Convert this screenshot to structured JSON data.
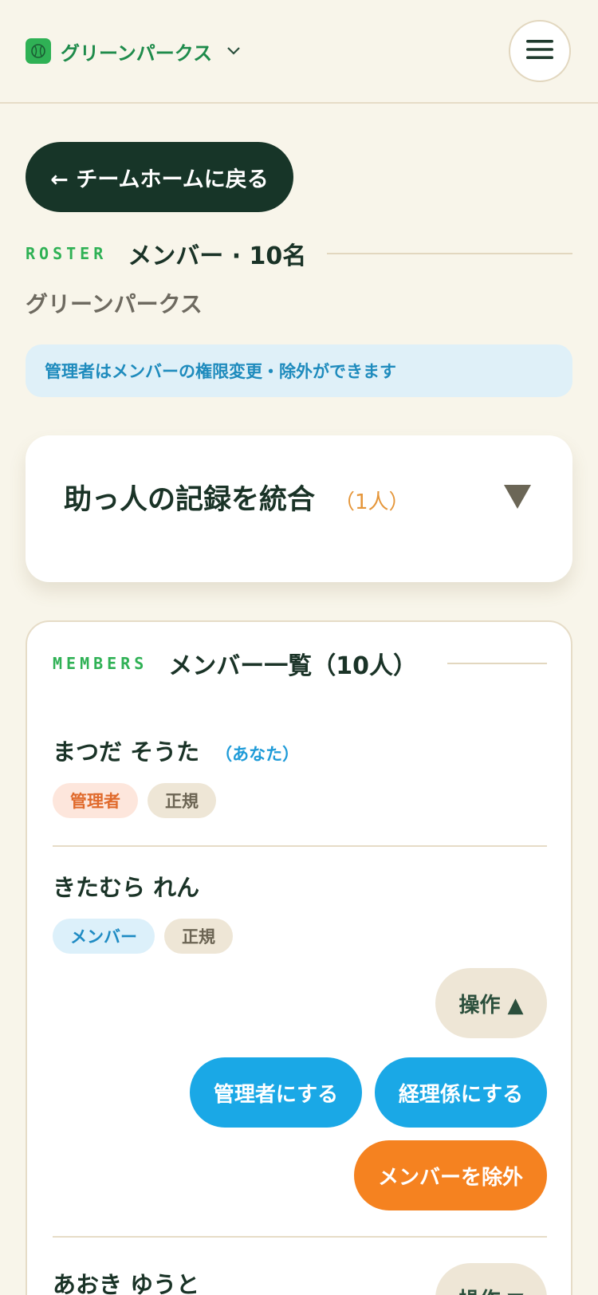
{
  "header": {
    "team_name": "グリーンパークス",
    "team_chevron": "⌄",
    "menu_icon": "hamburger-icon"
  },
  "nav": {
    "back_label": "← チームホームに戻る"
  },
  "roster": {
    "eyebrow": "ROSTER",
    "title": "メンバー · 10名",
    "team_subtitle": "グリーンパークス"
  },
  "notice": {
    "text": "管理者はメンバーの権限変更・除外ができます"
  },
  "merge": {
    "title": "助っ人の記録を統合",
    "count": "（1人）",
    "toggle_icon": "triangle-down-icon"
  },
  "members": {
    "eyebrow": "MEMBERS",
    "title": "メンバー一覧（10人）",
    "list": [
      {
        "name": "まつだ そうた",
        "you_tag": "（あなた）",
        "role": "管理者",
        "status": "正規"
      },
      {
        "name": "きたむら れん",
        "role": "メンバー",
        "status": "正規",
        "ops_label": "操作 ▲",
        "actions": {
          "make_admin": "管理者にする",
          "make_treasurer": "経理係にする",
          "remove": "メンバーを除外"
        }
      },
      {
        "name": "あおき ゆうと",
        "ops_label": "操作 ▼"
      }
    ]
  },
  "colors": {
    "background": "#f8f5ea",
    "primary_dark": "#173528",
    "accent_green": "#2fb155",
    "accent_blue": "#1aa8e6",
    "accent_orange": "#f58220"
  }
}
